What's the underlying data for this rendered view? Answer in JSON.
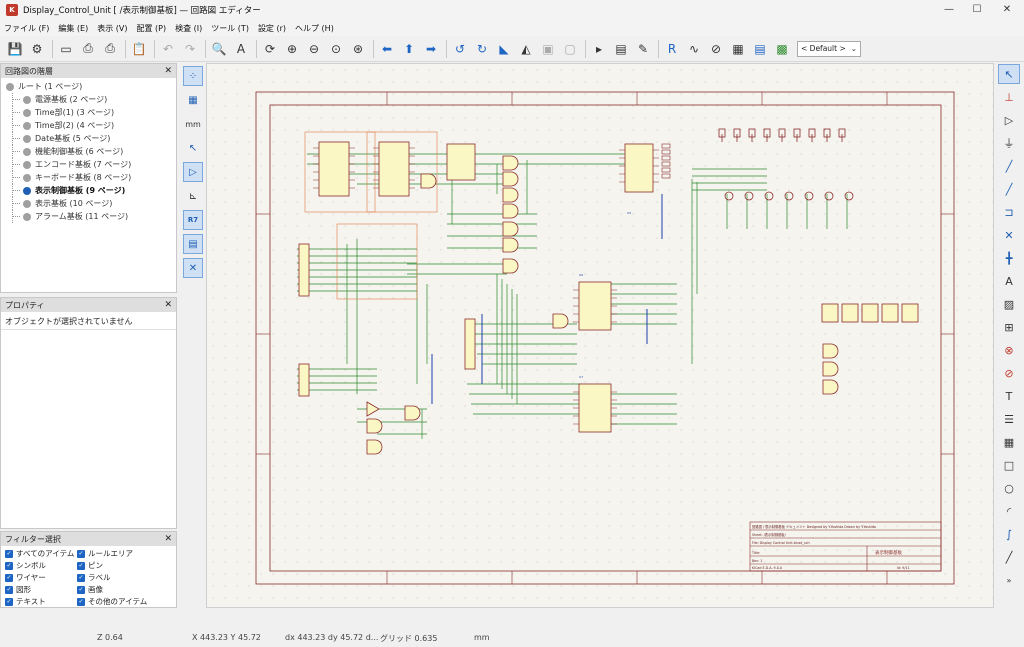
{
  "window": {
    "title": "Display_Control_Unit [        /表示制御基板] — 回路図 エディター",
    "minimize": "—",
    "maximize": "☐",
    "close": "✕"
  },
  "menu": [
    "ファイル (F)",
    "編集 (E)",
    "表示 (V)",
    "配置 (P)",
    "検査 (I)",
    "ツール (T)",
    "設定 (r)",
    "ヘルプ (H)"
  ],
  "toolbar": {
    "zoom_preset": "< Default >",
    "icons": [
      "save-icon",
      "schematic-setup-icon",
      "page-settings-icon",
      "print-icon",
      "plot-icon",
      "paste-icon",
      "undo-icon",
      "redo-icon",
      "find-icon",
      "find-replace-icon",
      "refresh-icon",
      "zoom-in-icon",
      "zoom-out-icon",
      "zoom-fit-icon",
      "zoom-objects-icon",
      "navigate-back-icon",
      "navigate-up-icon",
      "navigate-forward-icon",
      "rotate-ccw-icon",
      "rotate-cw-icon",
      "mirror-v-icon",
      "mirror-h-icon",
      "group-icon",
      "ungroup-icon",
      "symbol-editor-icon",
      "symbol-browser-icon",
      "annotate-icon",
      "erc-icon",
      "simulator-icon",
      "assign-footprints-icon",
      "bom-icon",
      "netlist-icon",
      "pcb-editor-icon"
    ]
  },
  "hierarchy": {
    "title": "回路図の階層",
    "root": "ルート (1 ページ)",
    "items": [
      {
        "label": "電源基板 (2 ページ)",
        "active": false
      },
      {
        "label": "Time部(1) (3 ページ)",
        "active": false
      },
      {
        "label": "Time部(2) (4 ページ)",
        "active": false
      },
      {
        "label": "Date基板 (5 ページ)",
        "active": false
      },
      {
        "label": "機能制御基板 (6 ページ)",
        "active": false
      },
      {
        "label": "エンコード基板 (7 ページ)",
        "active": false
      },
      {
        "label": "キーボード基板 (8 ページ)",
        "active": false
      },
      {
        "label": "表示制御基板 (9 ページ)",
        "active": true
      },
      {
        "label": "表示基板 (10 ページ)",
        "active": false
      },
      {
        "label": "アラーム基板 (11 ページ)",
        "active": false
      }
    ]
  },
  "properties": {
    "title": "プロパティ",
    "empty_text": "オブジェクトが選択されていません"
  },
  "filter": {
    "title": "フィルター選択",
    "left": [
      "すべてのアイテム",
      "シンボル",
      "ワイヤー",
      "図形",
      "テキスト"
    ],
    "right": [
      "ルールエリア",
      "ピン",
      "ラベル",
      "画像",
      "その他のアイテム"
    ]
  },
  "left_tools": [
    "grid-icon",
    "grid-overrides-icon",
    "units-mm-icon",
    "cursor-icon",
    "hidden-pins-icon",
    "wire-angle-icon",
    "annotate-refs-icon",
    "hierarchy-panel-icon",
    "properties-panel-icon"
  ],
  "right_tools": [
    "select-icon",
    "highlight-net-icon",
    "add-symbol-icon",
    "add-power-icon",
    "add-wire-icon",
    "add-bus-icon",
    "bus-entry-icon",
    "no-connect-icon",
    "junction-icon",
    "net-label-icon",
    "global-label-icon",
    "hier-label-icon",
    "hier-sheet-icon",
    "import-sheet-pin-icon",
    "sync-sheet-pins-icon",
    "text-icon",
    "textbox-icon",
    "table-icon",
    "rectangle-icon",
    "circle-icon",
    "arc-icon",
    "bezier-icon",
    "line-icon",
    "more-icon"
  ],
  "status": {
    "zoom": "Z 0.64",
    "xy": "X 443.23  Y 45.72",
    "dxdy": "dx 443.23  dy 45.72  d...",
    "grid": "グリッド 0.635",
    "units": "mm"
  },
  "titleblock": {
    "line1": "回路図 / 表示制御基板 ドキュメント   Designed by Y.Yoshida    Drawn by Y.Yoshida",
    "line2": "Sheet: /表示制御基板/",
    "line3": "File: Display Control Unit.kicad_sch",
    "title": "Title:",
    "sheet_name": "表示制御基板",
    "rev": "Rev: 1",
    "kicad": "KiCad E.D.A. 9.0.0",
    "id": "Id: 9/11"
  }
}
